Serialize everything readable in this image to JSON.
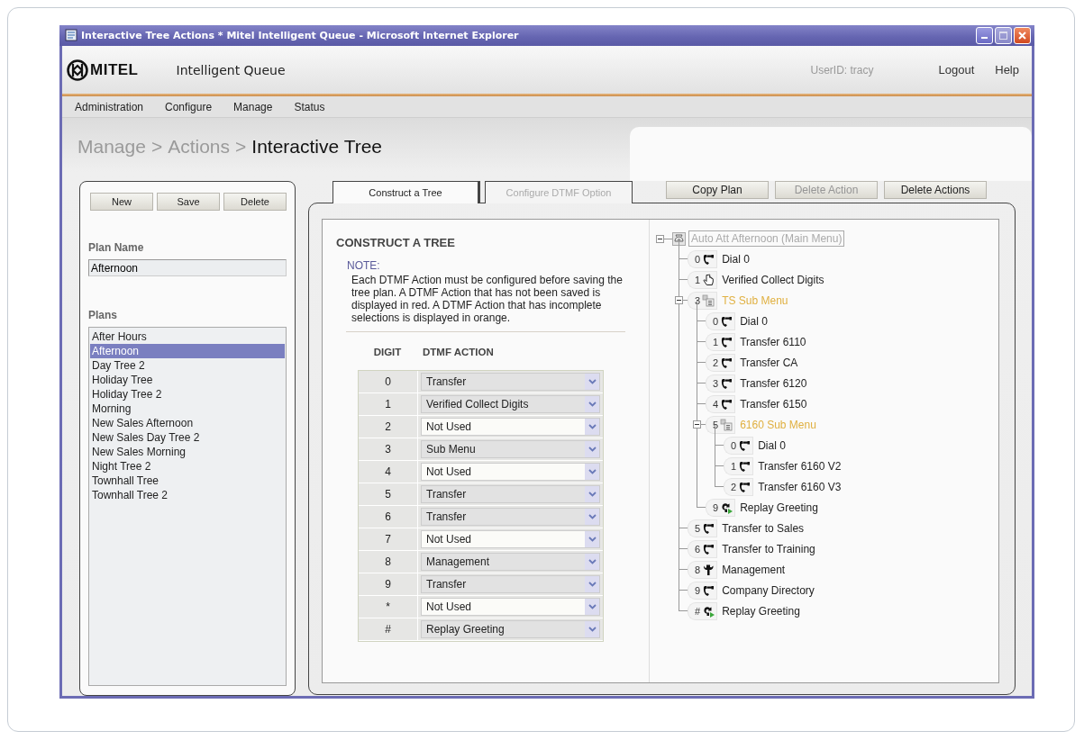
{
  "window": {
    "title": "Interactive Tree Actions * Mitel Intelligent Queue - Microsoft Internet Explorer"
  },
  "header": {
    "logo": "MITEL",
    "app_name": "Intelligent Queue",
    "user": "UserID: tracy",
    "links": [
      "Logout",
      "Help"
    ]
  },
  "nav": [
    "Administration",
    "Configure",
    "Manage",
    "Status"
  ],
  "breadcrumb": {
    "items": [
      {
        "label": "Manage",
        "current": false
      },
      {
        "label": "Actions",
        "current": false
      },
      {
        "label": "Interactive Tree",
        "current": true
      }
    ],
    "separators": [
      ">",
      ">"
    ]
  },
  "left_panel": {
    "buttons": [
      "New",
      "Save",
      "Delete"
    ],
    "plan_name_label": "Plan Name",
    "plan_name": "Afternoon",
    "plans_label": "Plans",
    "plans": [
      {
        "label": "After Hours",
        "selected": false
      },
      {
        "label": "Afternoon",
        "selected": true
      },
      {
        "label": "Day Tree 2",
        "selected": false
      },
      {
        "label": "Holiday Tree",
        "selected": false
      },
      {
        "label": "Holiday Tree 2",
        "selected": false
      },
      {
        "label": "Morning",
        "selected": false
      },
      {
        "label": "New Sales Afternoon",
        "selected": false
      },
      {
        "label": "New Sales Day Tree 2",
        "selected": false
      },
      {
        "label": "New Sales Morning",
        "selected": false
      },
      {
        "label": "Night Tree 2",
        "selected": false
      },
      {
        "label": "Townhall Tree",
        "selected": false
      },
      {
        "label": "Townhall Tree 2",
        "selected": false
      }
    ]
  },
  "tabs": [
    {
      "label": "Construct a Tree",
      "selected": true
    },
    {
      "label": "Configure DTMF Option",
      "selected": false
    }
  ],
  "actions": [
    {
      "label": "Copy Plan",
      "disabled": false
    },
    {
      "label": "Delete Action",
      "disabled": true
    },
    {
      "label": "Delete Actions",
      "disabled": false
    }
  ],
  "construct": {
    "title": "CONSTRUCT A TREE",
    "note_label": "NOTE:",
    "note": "Each DTMF Action must be configured before saving the tree plan. A DTMF Action that has not been saved is displayed in red. A DTMF Action that has incomplete selections is displayed in orange.",
    "columns": [
      "DIGIT",
      "DTMF ACTION"
    ],
    "rows": [
      {
        "digit": "0",
        "action": "Transfer",
        "used": true
      },
      {
        "digit": "1",
        "action": "Verified Collect Digits",
        "used": true
      },
      {
        "digit": "2",
        "action": "Not Used",
        "used": false
      },
      {
        "digit": "3",
        "action": "Sub Menu",
        "used": true
      },
      {
        "digit": "4",
        "action": "Not Used",
        "used": false
      },
      {
        "digit": "5",
        "action": "Transfer",
        "used": true
      },
      {
        "digit": "6",
        "action": "Transfer",
        "used": true
      },
      {
        "digit": "7",
        "action": "Not Used",
        "used": false
      },
      {
        "digit": "8",
        "action": "Management",
        "used": true
      },
      {
        "digit": "9",
        "action": "Transfer",
        "used": true
      },
      {
        "digit": "*",
        "action": "Not Used",
        "used": false
      },
      {
        "digit": "#",
        "action": "Replay Greeting",
        "used": true
      }
    ]
  },
  "tree": {
    "root": {
      "label": "Auto Att Afternoon (Main Menu)",
      "selected": true,
      "expanded": true
    },
    "children": [
      {
        "digit": "0",
        "kind": "transfer",
        "label": "Dial 0",
        "incomplete": false
      },
      {
        "digit": "1",
        "kind": "collect",
        "label": "Verified Collect Digits",
        "incomplete": false
      },
      {
        "digit": "3",
        "kind": "submenu",
        "label": "TS Sub Menu",
        "incomplete": true,
        "expanded": true,
        "children": [
          {
            "digit": "0",
            "kind": "transfer",
            "label": "Dial 0",
            "incomplete": false
          },
          {
            "digit": "1",
            "kind": "transfer",
            "label": "Transfer 6110",
            "incomplete": false
          },
          {
            "digit": "2",
            "kind": "transfer",
            "label": "Transfer CA",
            "incomplete": false
          },
          {
            "digit": "3",
            "kind": "transfer",
            "label": "Transfer 6120",
            "incomplete": false
          },
          {
            "digit": "4",
            "kind": "transfer",
            "label": "Transfer 6150",
            "incomplete": false
          },
          {
            "digit": "5",
            "kind": "submenu",
            "label": "6160 Sub Menu",
            "incomplete": true,
            "expanded": true,
            "children": [
              {
                "digit": "0",
                "kind": "transfer",
                "label": "Dial 0",
                "incomplete": false
              },
              {
                "digit": "1",
                "kind": "transfer",
                "label": "Transfer 6160 V2",
                "incomplete": false
              },
              {
                "digit": "2",
                "kind": "transfer",
                "label": "Transfer 6160 V3",
                "incomplete": false
              }
            ]
          },
          {
            "digit": "9",
            "kind": "replay",
            "label": "Replay Greeting",
            "incomplete": false
          }
        ]
      },
      {
        "digit": "5",
        "kind": "transfer",
        "label": "Transfer to Sales",
        "incomplete": false
      },
      {
        "digit": "6",
        "kind": "transfer",
        "label": "Transfer to Training",
        "incomplete": false
      },
      {
        "digit": "8",
        "kind": "management",
        "label": "Management",
        "incomplete": false
      },
      {
        "digit": "9",
        "kind": "transfer",
        "label": "Company Directory",
        "incomplete": false
      },
      {
        "digit": "#",
        "kind": "replay",
        "label": "Replay Greeting",
        "incomplete": false
      }
    ]
  }
}
